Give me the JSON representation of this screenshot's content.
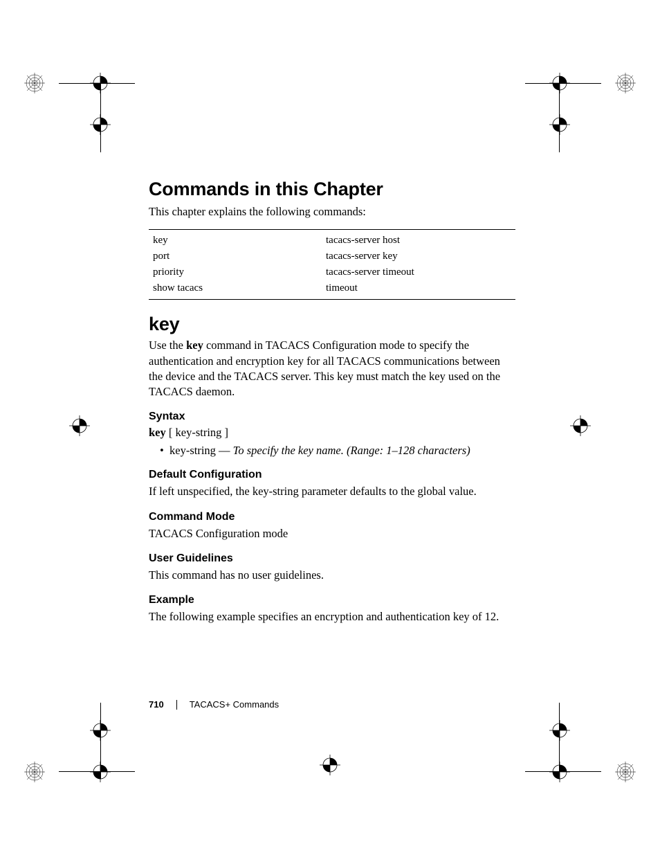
{
  "headings": {
    "chapter": "Commands in this Chapter",
    "intro": "This chapter explains the following commands:",
    "key": "key"
  },
  "commands_table": {
    "rows": [
      {
        "c1": "key",
        "c2": "tacacs-server host"
      },
      {
        "c1": "port",
        "c2": "tacacs-server key"
      },
      {
        "c1": "priority",
        "c2": "tacacs-server timeout"
      },
      {
        "c1": "show tacacs",
        "c2": "timeout"
      }
    ]
  },
  "key_section": {
    "desc_pre": "Use the ",
    "desc_cmd": "key",
    "desc_post": " command in TACACS Configuration mode to specify the authentication and encryption key for all TACACS communications between the device and the TACACS server. This key must match the key used on the TACACS daemon.",
    "syntax_h": "Syntax",
    "syntax_bold": "key",
    "syntax_rest": " [ key-string ]",
    "bullet_label": "key-string — ",
    "bullet_desc": "To specify the key name. (Range: 1–128 characters)",
    "default_h": "Default Configuration",
    "default_body": "If left unspecified, the key-string parameter defaults to the global value.",
    "mode_h": "Command Mode",
    "mode_body": "TACACS Configuration mode",
    "guide_h": "User Guidelines",
    "guide_body": "This command has no user guidelines.",
    "example_h": "Example",
    "example_body": "The following example specifies an encryption and authentication key of 12."
  },
  "footer": {
    "page": "710",
    "section": "TACACS+ Commands"
  }
}
